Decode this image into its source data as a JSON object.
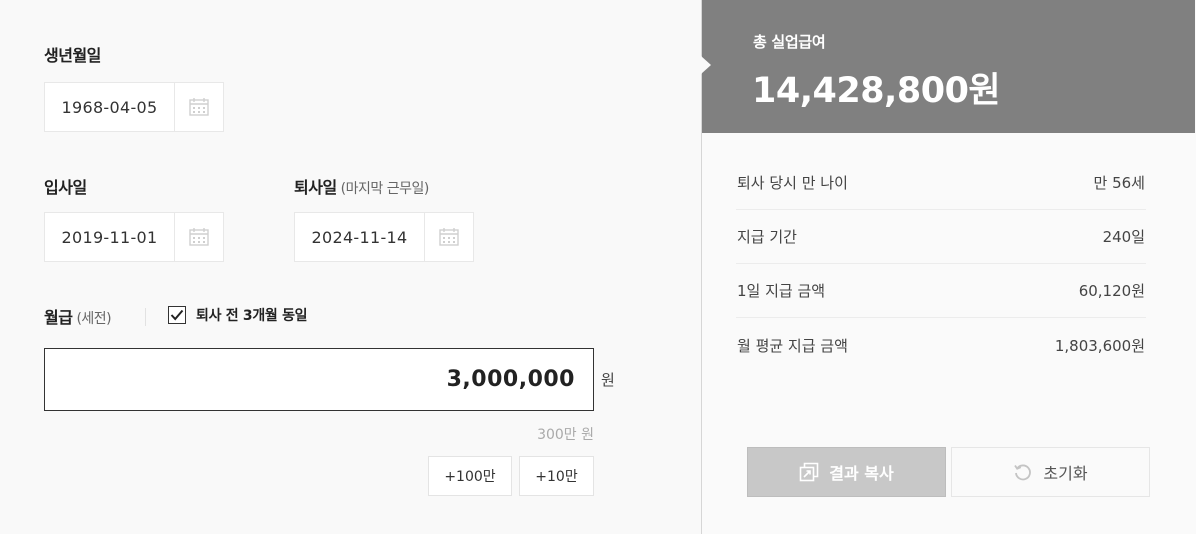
{
  "form": {
    "birth": {
      "label": "생년월일",
      "value": "1968-04-05"
    },
    "join": {
      "label": "입사일",
      "value": "2019-11-01"
    },
    "leave": {
      "label": "퇴사일",
      "sub": "(마지막 근무일)",
      "value": "2024-11-14"
    },
    "salary": {
      "label": "월급",
      "sub": "(세전)",
      "same_checkbox_label": "퇴사 전 3개월 동일",
      "same_checked": true,
      "value": "3,000,000",
      "unit": "원",
      "hint": "300만 원",
      "buttons": [
        "+100만",
        "+10만"
      ]
    }
  },
  "result": {
    "total_label": "총 실업급여",
    "total_value": "14,428,800원",
    "rows": [
      {
        "label": "퇴사 당시 만 나이",
        "value": "만 56세"
      },
      {
        "label": "지급 기간",
        "value": "240일"
      },
      {
        "label": "1일 지급 금액",
        "value": "60,120원"
      },
      {
        "label": "월 평균 지급 금액",
        "value": "1,803,600원"
      }
    ],
    "copy_button": "결과 복사",
    "reset_button": "초기화"
  },
  "colors": {
    "total_bg": "#808080",
    "copy_btn_bg": "#c8c8c8"
  },
  "icons": [
    "calendar-icon",
    "check-icon",
    "copy-icon",
    "reset-icon"
  ]
}
